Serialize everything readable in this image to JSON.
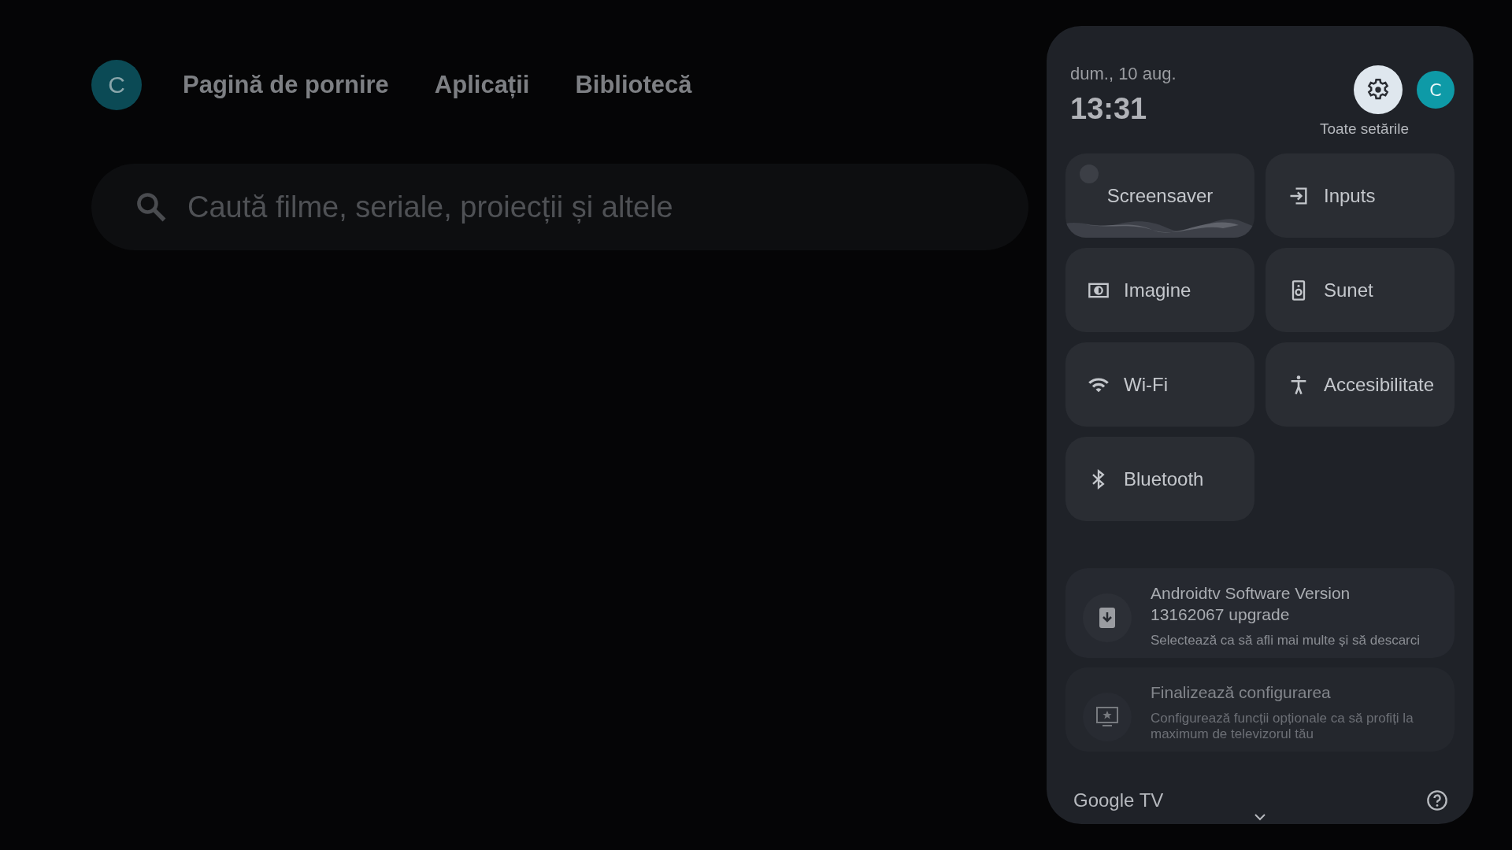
{
  "profile": {
    "initial": "C"
  },
  "nav": [
    {
      "label": "Pagină de pornire"
    },
    {
      "label": "Aplicații"
    },
    {
      "label": "Bibliotecă"
    }
  ],
  "search": {
    "placeholder": "Caută filme, seriale, proiecții și altele"
  },
  "panel": {
    "date": "dum., 10 aug.",
    "time": "13:31",
    "settings_label": "Toate setările",
    "profile_initial": "C",
    "tiles": [
      {
        "kind": "screensaver",
        "label": "Screensaver"
      },
      {
        "kind": "inputs",
        "label": "Inputs"
      },
      {
        "kind": "picture",
        "label": "Imagine"
      },
      {
        "kind": "sound",
        "label": "Sunet"
      },
      {
        "kind": "wifi",
        "label": "Wi-Fi"
      },
      {
        "kind": "accessibility",
        "label": "Accesibilitate"
      },
      {
        "kind": "bluetooth",
        "label": "Bluetooth"
      }
    ],
    "notifications": [
      {
        "kind": "download",
        "faded": false,
        "title": "Androidtv Software Version 13162067 upgrade",
        "body": "Selectează ca să afli mai multe și să descarci"
      },
      {
        "kind": "setup",
        "faded": true,
        "title": "Finalizează configurarea",
        "body": "Configurează funcții opționale ca să profiți la maximum de televizorul tău"
      }
    ],
    "brand": "Google TV"
  }
}
